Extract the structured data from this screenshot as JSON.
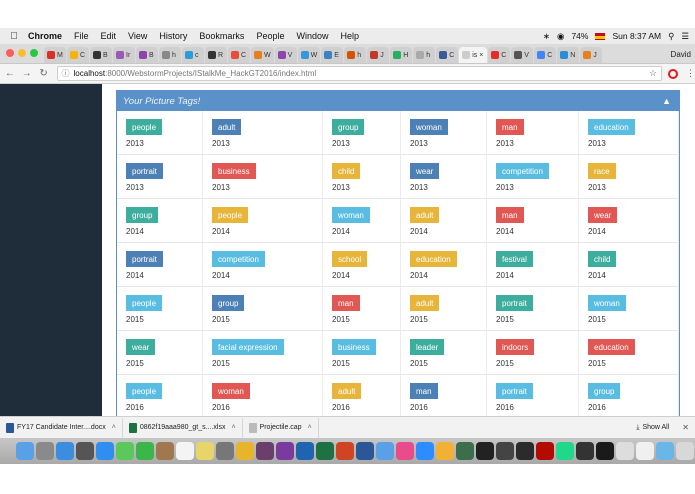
{
  "menubar": {
    "app": "Chrome",
    "items": [
      "File",
      "Edit",
      "View",
      "History",
      "Bookmarks",
      "People",
      "Window",
      "Help"
    ],
    "battery": "74%",
    "clock": "Sun 8:37 AM"
  },
  "browser": {
    "tabs": [
      {
        "label": "M",
        "color": "#d93025"
      },
      {
        "label": "C",
        "color": "#f4b400"
      },
      {
        "label": "B",
        "color": "#333333"
      },
      {
        "label": "Ir",
        "color": "#9b59b6"
      },
      {
        "label": "B",
        "color": "#8e44ad"
      },
      {
        "label": "h",
        "color": "#888888"
      },
      {
        "label": "c",
        "color": "#2c9cd5"
      },
      {
        "label": "R",
        "color": "#333333"
      },
      {
        "label": "C",
        "color": "#e74c3c"
      },
      {
        "label": "W",
        "color": "#e67e22"
      },
      {
        "label": "V",
        "color": "#8e44ad"
      },
      {
        "label": "W",
        "color": "#3498db"
      },
      {
        "label": "E",
        "color": "#3b82c4"
      },
      {
        "label": "h",
        "color": "#d35400"
      },
      {
        "label": "J",
        "color": "#c0392b"
      },
      {
        "label": "H",
        "color": "#27ae60"
      },
      {
        "label": "h",
        "color": "#aaaaaa"
      },
      {
        "label": "C",
        "color": "#3b5998"
      },
      {
        "label": "is",
        "color": "#cccccc",
        "active": true
      },
      {
        "label": "C",
        "color": "#e52d27"
      },
      {
        "label": "V",
        "color": "#555555"
      },
      {
        "label": "C",
        "color": "#4285f4"
      },
      {
        "label": "N",
        "color": "#2c8dd6"
      },
      {
        "label": "J",
        "color": "#e67e22"
      }
    ],
    "user": "David",
    "url_host": "localhost",
    "url_path": ":8000/WebstormProjects/IStalkMe_HackGT2016/index.html"
  },
  "panel": {
    "title": "Your Picture Tags!"
  },
  "tag_rows": [
    [
      {
        "tag": "people",
        "year": "2013",
        "color": "#3dae9e"
      },
      {
        "tag": "adult",
        "year": "2013",
        "color": "#4d80b5"
      },
      {
        "tag": "group",
        "year": "2013",
        "color": "#3dae9e"
      },
      {
        "tag": "woman",
        "year": "2013",
        "color": "#4d80b5"
      },
      {
        "tag": "man",
        "year": "2013",
        "color": "#e05753"
      },
      {
        "tag": "education",
        "year": "2013",
        "color": "#58bde0"
      }
    ],
    [
      {
        "tag": "portrait",
        "year": "2013",
        "color": "#4d80b5"
      },
      {
        "tag": "business",
        "year": "2013",
        "color": "#e05753"
      },
      {
        "tag": "child",
        "year": "2013",
        "color": "#e6b53a"
      },
      {
        "tag": "wear",
        "year": "2013",
        "color": "#4d80b5"
      },
      {
        "tag": "competition",
        "year": "2013",
        "color": "#58bde0"
      },
      {
        "tag": "race",
        "year": "2013",
        "color": "#e6b53a"
      }
    ],
    [
      {
        "tag": "group",
        "year": "2014",
        "color": "#3dae9e"
      },
      {
        "tag": "people",
        "year": "2014",
        "color": "#e6b53a"
      },
      {
        "tag": "woman",
        "year": "2014",
        "color": "#58bde0"
      },
      {
        "tag": "adult",
        "year": "2014",
        "color": "#e6b53a"
      },
      {
        "tag": "man",
        "year": "2014",
        "color": "#e05753"
      },
      {
        "tag": "wear",
        "year": "2014",
        "color": "#e05753"
      }
    ],
    [
      {
        "tag": "portrait",
        "year": "2014",
        "color": "#4d80b5"
      },
      {
        "tag": "competition",
        "year": "2014",
        "color": "#58bde0"
      },
      {
        "tag": "school",
        "year": "2014",
        "color": "#e6b53a"
      },
      {
        "tag": "education",
        "year": "2014",
        "color": "#e6b53a"
      },
      {
        "tag": "festival",
        "year": "2014",
        "color": "#3dae9e"
      },
      {
        "tag": "child",
        "year": "2014",
        "color": "#3dae9e"
      }
    ],
    [
      {
        "tag": "people",
        "year": "2015",
        "color": "#58bde0"
      },
      {
        "tag": "group",
        "year": "2015",
        "color": "#4d80b5"
      },
      {
        "tag": "man",
        "year": "2015",
        "color": "#e05753"
      },
      {
        "tag": "adult",
        "year": "2015",
        "color": "#e6b53a"
      },
      {
        "tag": "portrait",
        "year": "2015",
        "color": "#3dae9e"
      },
      {
        "tag": "woman",
        "year": "2015",
        "color": "#58bde0"
      }
    ],
    [
      {
        "tag": "wear",
        "year": "2015",
        "color": "#3dae9e"
      },
      {
        "tag": "facial expression",
        "year": "2015",
        "color": "#58bde0"
      },
      {
        "tag": "business",
        "year": "2015",
        "color": "#58bde0"
      },
      {
        "tag": "leader",
        "year": "2015",
        "color": "#3dae9e"
      },
      {
        "tag": "indoors",
        "year": "2015",
        "color": "#e05753"
      },
      {
        "tag": "education",
        "year": "2015",
        "color": "#e05753"
      }
    ],
    [
      {
        "tag": "people",
        "year": "2016",
        "color": "#58bde0"
      },
      {
        "tag": "woman",
        "year": "2016",
        "color": "#e05753"
      },
      {
        "tag": "adult",
        "year": "2016",
        "color": "#e6b53a"
      },
      {
        "tag": "man",
        "year": "2016",
        "color": "#4d80b5"
      },
      {
        "tag": "portrait",
        "year": "2016",
        "color": "#58bde0"
      },
      {
        "tag": "group",
        "year": "2016",
        "color": "#58bde0"
      }
    ]
  ],
  "downloads": [
    {
      "name": "FY17 Candidate Inter....docx",
      "color": "#2b5797"
    },
    {
      "name": "0862f19aaa980_gt_s....xlsx",
      "color": "#1e7145"
    },
    {
      "name": "Projectile.cap",
      "color": "#bbbbbb"
    }
  ],
  "download_bar": {
    "show_all": "Show All"
  },
  "dock_icons": [
    {
      "name": "finder",
      "color": "#5aa0e6"
    },
    {
      "name": "launchpad",
      "color": "#8a8a8a"
    },
    {
      "name": "safari",
      "color": "#3b8de0"
    },
    {
      "name": "photos",
      "color": "#555555"
    },
    {
      "name": "app-store",
      "color": "#2f8ef0"
    },
    {
      "name": "messages",
      "color": "#5bc85b"
    },
    {
      "name": "facetime",
      "color": "#3cb54a"
    },
    {
      "name": "contacts",
      "color": "#a07850"
    },
    {
      "name": "calendar",
      "color": "#f4f4f4"
    },
    {
      "name": "notes",
      "color": "#e8d56a"
    },
    {
      "name": "preferences",
      "color": "#777777"
    },
    {
      "name": "chrome",
      "color": "#e8b42c"
    },
    {
      "name": "slack",
      "color": "#6b3f6b"
    },
    {
      "name": "onenote",
      "color": "#7a3a9e"
    },
    {
      "name": "outlook",
      "color": "#1f64b0"
    },
    {
      "name": "excel",
      "color": "#1e7145"
    },
    {
      "name": "powerpoint",
      "color": "#d04423"
    },
    {
      "name": "word",
      "color": "#2b5797"
    },
    {
      "name": "mail",
      "color": "#5aa0e6"
    },
    {
      "name": "itunes",
      "color": "#e94c8a"
    },
    {
      "name": "zoom",
      "color": "#2d8cff"
    },
    {
      "name": "preview",
      "color": "#f2b134"
    },
    {
      "name": "atom",
      "color": "#3c6e4b"
    },
    {
      "name": "terminal",
      "color": "#222222"
    },
    {
      "name": "activity",
      "color": "#444444"
    },
    {
      "name": "ibooks",
      "color": "#2b2b2b"
    },
    {
      "name": "acrobat",
      "color": "#b30b00"
    },
    {
      "name": "pycharm",
      "color": "#21d789"
    },
    {
      "name": "github",
      "color": "#333333"
    },
    {
      "name": "webstorm",
      "color": "#1a1a1a"
    },
    {
      "name": "files",
      "color": "#dddddd"
    },
    {
      "name": "document",
      "color": "#f0f0f0"
    },
    {
      "name": "folder",
      "color": "#6bb6e8"
    },
    {
      "name": "trash",
      "color": "#d8d8d8"
    }
  ]
}
